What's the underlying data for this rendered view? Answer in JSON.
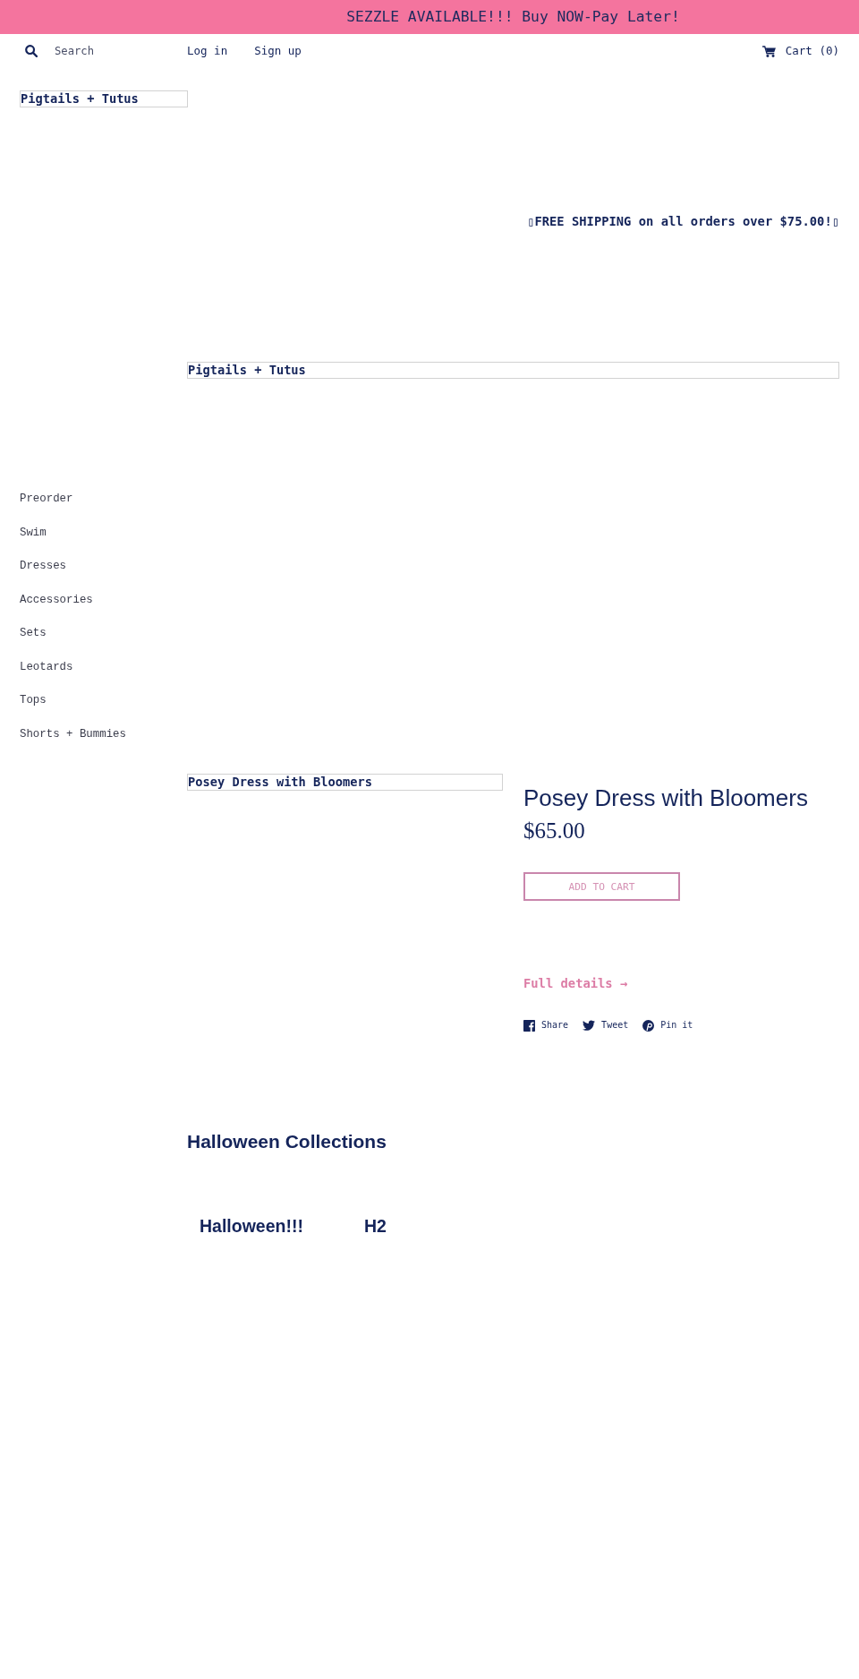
{
  "announcement_bar": {
    "text": "SEZZLE AVAILABLE!!! Buy NOW-Pay Later!"
  },
  "header": {
    "search": {
      "placeholder": "Search"
    },
    "links": [
      "Log in",
      "Sign up"
    ],
    "cart": "Cart (0)"
  },
  "logo": {
    "alt_text": "Pigtails + Tutus"
  },
  "promo": {
    "text": "▯FREE SHIPPING on all orders over $75.00!▯"
  },
  "banner": {
    "alt_text": "Pigtails + Tutus"
  },
  "sidebar": {
    "items": [
      "Preorder",
      "Swim",
      "Dresses",
      "Accessories",
      "Sets",
      "Leotards",
      "Tops",
      "Shorts + Bummies"
    ]
  },
  "product": {
    "image_alt_text": "Posey Dress with Bloomers",
    "title": "Posey Dress with Bloomers",
    "price": "$65.00",
    "add_to_cart": "ADD TO CART",
    "full_details": "Full details →",
    "share": [
      {
        "kind": "facebook",
        "label": "Share"
      },
      {
        "kind": "twitter",
        "label": "Tweet"
      },
      {
        "kind": "pinterest",
        "label": "Pin it"
      }
    ]
  },
  "collections": {
    "title": "Halloween Collections",
    "items": [
      "Halloween!!!",
      "H2"
    ]
  }
}
